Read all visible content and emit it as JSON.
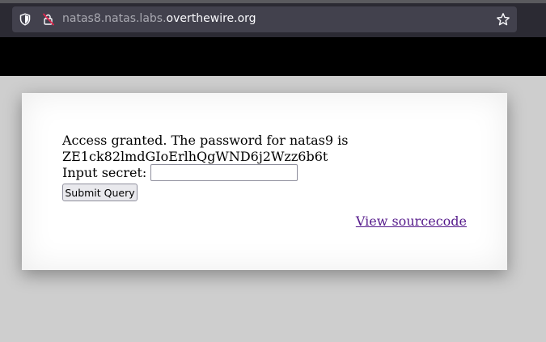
{
  "browser": {
    "url_prefix": "natas8.natas.labs.",
    "url_domain": "overthewire.org",
    "icons": {
      "tracking_protection": "shield-icon",
      "connection": "lock-warning-icon",
      "bookmark": "star-icon"
    }
  },
  "page": {
    "message_line1": "Access granted. The password for natas9 is",
    "message_line2": "ZE1ck82lmdGIoErlhQgWND6j2Wzz6b6t",
    "secret_label": "Input secret:",
    "secret_value": "",
    "submit_label": "Submit Query",
    "view_source_label": "View sourcecode",
    "link_color": "#551a8b"
  }
}
